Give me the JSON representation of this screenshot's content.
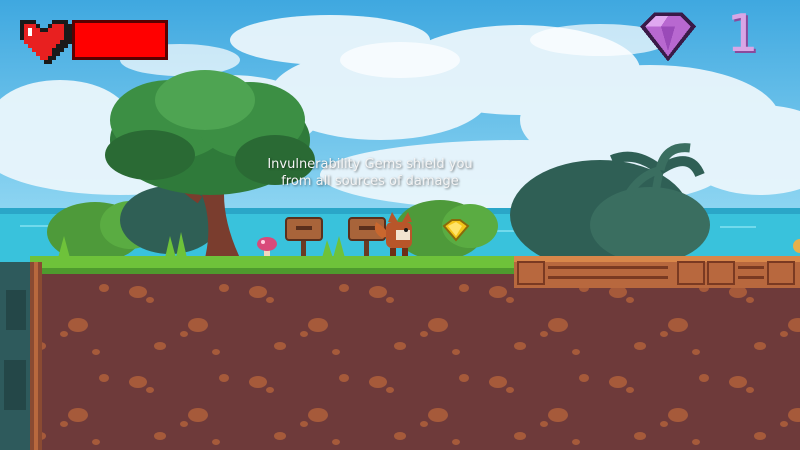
{
  "hud": {
    "health_level": 1.0,
    "gem_count": "1"
  },
  "tooltip": {
    "text": "Invulnerability Gems shield you from all sources of damage"
  },
  "colors": {
    "sky": "#4fb6e8",
    "sea": "#39c2dc",
    "grass": "#6ec23a",
    "dirt": "#6e3a3a",
    "health": "#ff0000",
    "gem_hud": "#b868d0",
    "gem_pickup": "#f5c518"
  }
}
